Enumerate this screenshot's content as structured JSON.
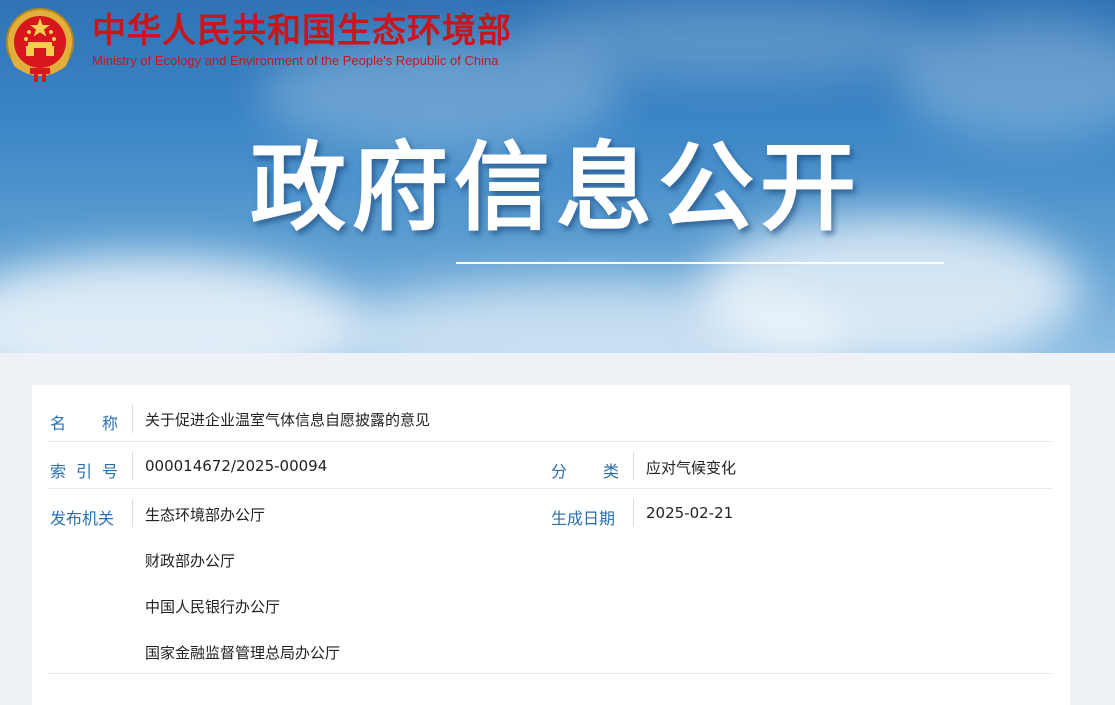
{
  "header": {
    "emblem_icon": "national-emblem-icon",
    "ministry_name_cn": "中华人民共和国生态环境部",
    "ministry_name_en": "Ministry of Ecology and Environment of the People's Republic of China",
    "section_title": "政府信息公开"
  },
  "info": {
    "name_label": "名 称",
    "name_value": "关于促进企业温室气体信息自愿披露的意见",
    "index_label": "索 引 号",
    "index_value": "000014672/2025-00094",
    "category_label": "分 类",
    "category_value": "应对气候变化",
    "issuer_label": "发布机关",
    "issuers": [
      "生态环境部办公厅",
      "财政部办公厅",
      "中国人民银行办公厅",
      "国家金融监督管理总局办公厅"
    ],
    "date_label": "生成日期",
    "date_value": "2025-02-21"
  },
  "colors": {
    "label_blue": "#2a6fb0",
    "ministry_red": "#c8161d",
    "banner_blue": "#3b86c6"
  }
}
